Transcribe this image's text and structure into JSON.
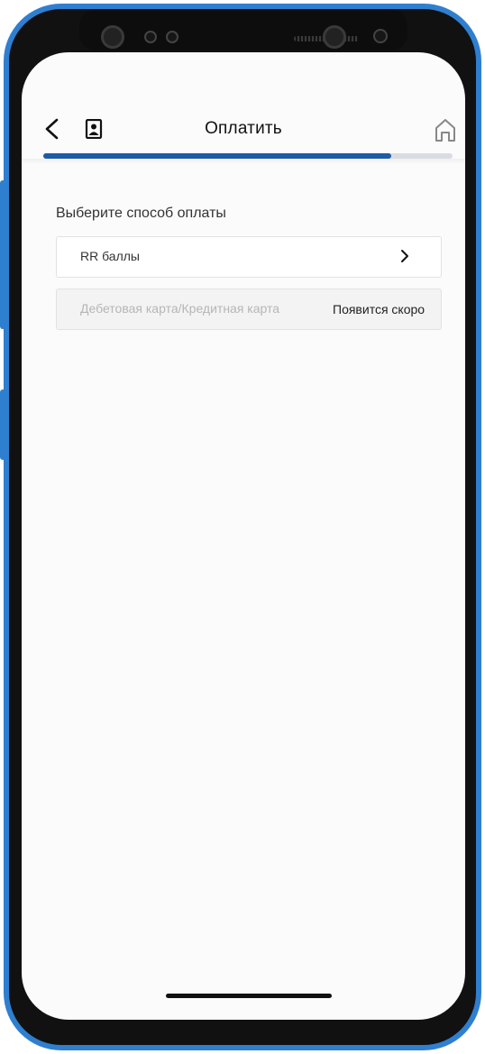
{
  "header": {
    "title": "Оплатить",
    "back_icon": "chevron-left-icon",
    "contact_icon": "contact-book-icon",
    "home_icon": "home-icon",
    "progress": 0.85
  },
  "payment": {
    "section_label": "Выберите способ оплаты",
    "options": [
      {
        "label": "RR баллы",
        "icon": "chevron-right-icon",
        "enabled": true
      },
      {
        "label": "Дебетовая карта/Кредитная карта",
        "status": "Появится скоро",
        "enabled": false
      }
    ]
  },
  "colors": {
    "accent": "#1f5aa7",
    "phone_frame": "#2f7fd0"
  }
}
